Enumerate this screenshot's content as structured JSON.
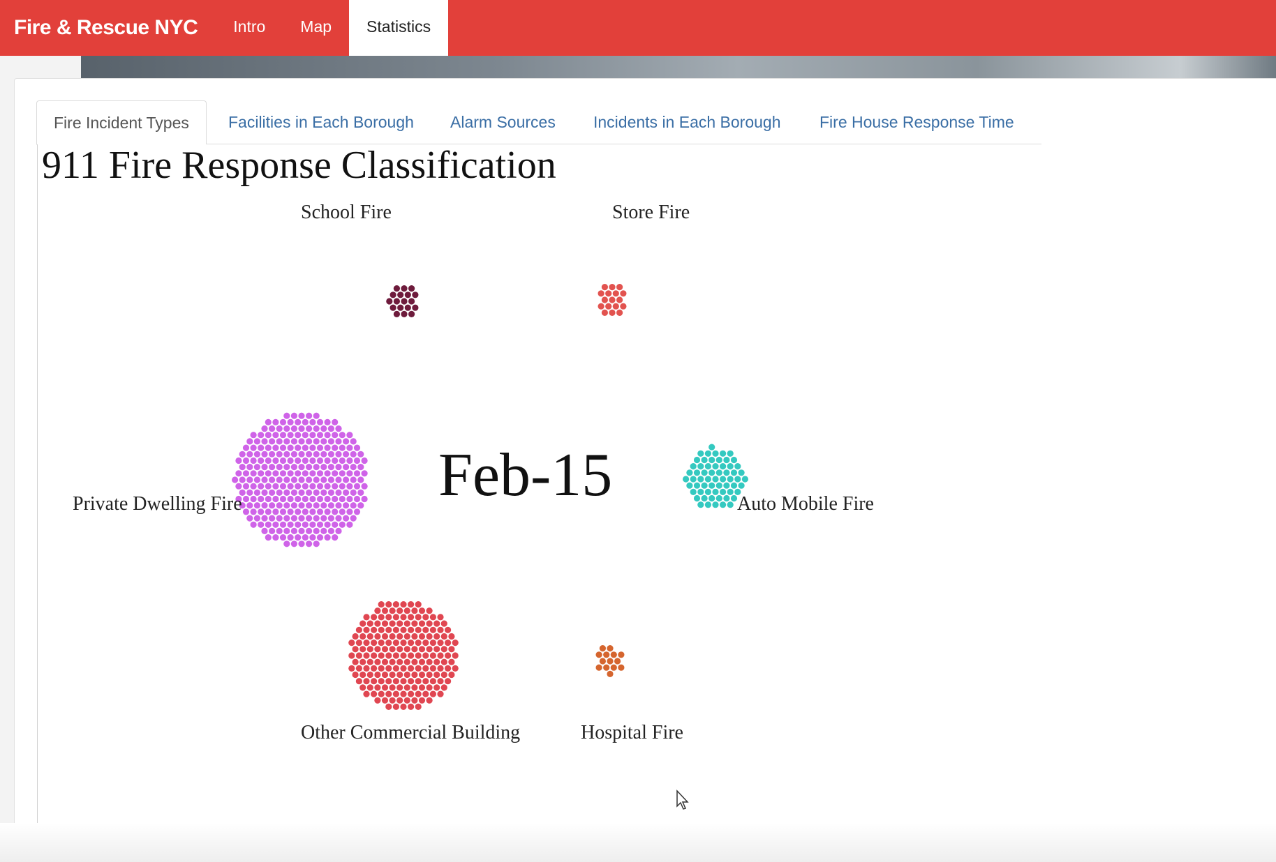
{
  "navbar": {
    "brand": "Fire & Rescue NYC",
    "items": [
      {
        "label": "Intro"
      },
      {
        "label": "Map"
      },
      {
        "label": "Statistics"
      }
    ],
    "active_item": "Statistics"
  },
  "tabs": [
    {
      "label": "Fire Incident Types"
    },
    {
      "label": "Facilities in Each Borough"
    },
    {
      "label": "Alarm Sources"
    },
    {
      "label": "Incidents in Each Borough"
    },
    {
      "label": "Fire House Response Time"
    }
  ],
  "active_tab": "Fire Incident Types",
  "chart_data": {
    "type": "scatter",
    "title": "911 Fire Response Classification",
    "date_label": "Feb-15",
    "groups": [
      {
        "name": "School Fire",
        "count": 18,
        "color": "#6e1b3c"
      },
      {
        "name": "Store Fire",
        "count": 17,
        "color": "#e2534f"
      },
      {
        "name": "Private Dwelling Fire",
        "count": 300,
        "color": "#cf63e8"
      },
      {
        "name": "Auto Mobile Fire",
        "count": 62,
        "color": "#34c9c0"
      },
      {
        "name": "Other Commercial Building",
        "count": 200,
        "color": "#e04651"
      },
      {
        "name": "Hospital Fire",
        "count": 14,
        "color": "#d5652e"
      }
    ]
  },
  "colors": {
    "navbar": "#e2403a",
    "tab_link": "#3a6ea5"
  }
}
